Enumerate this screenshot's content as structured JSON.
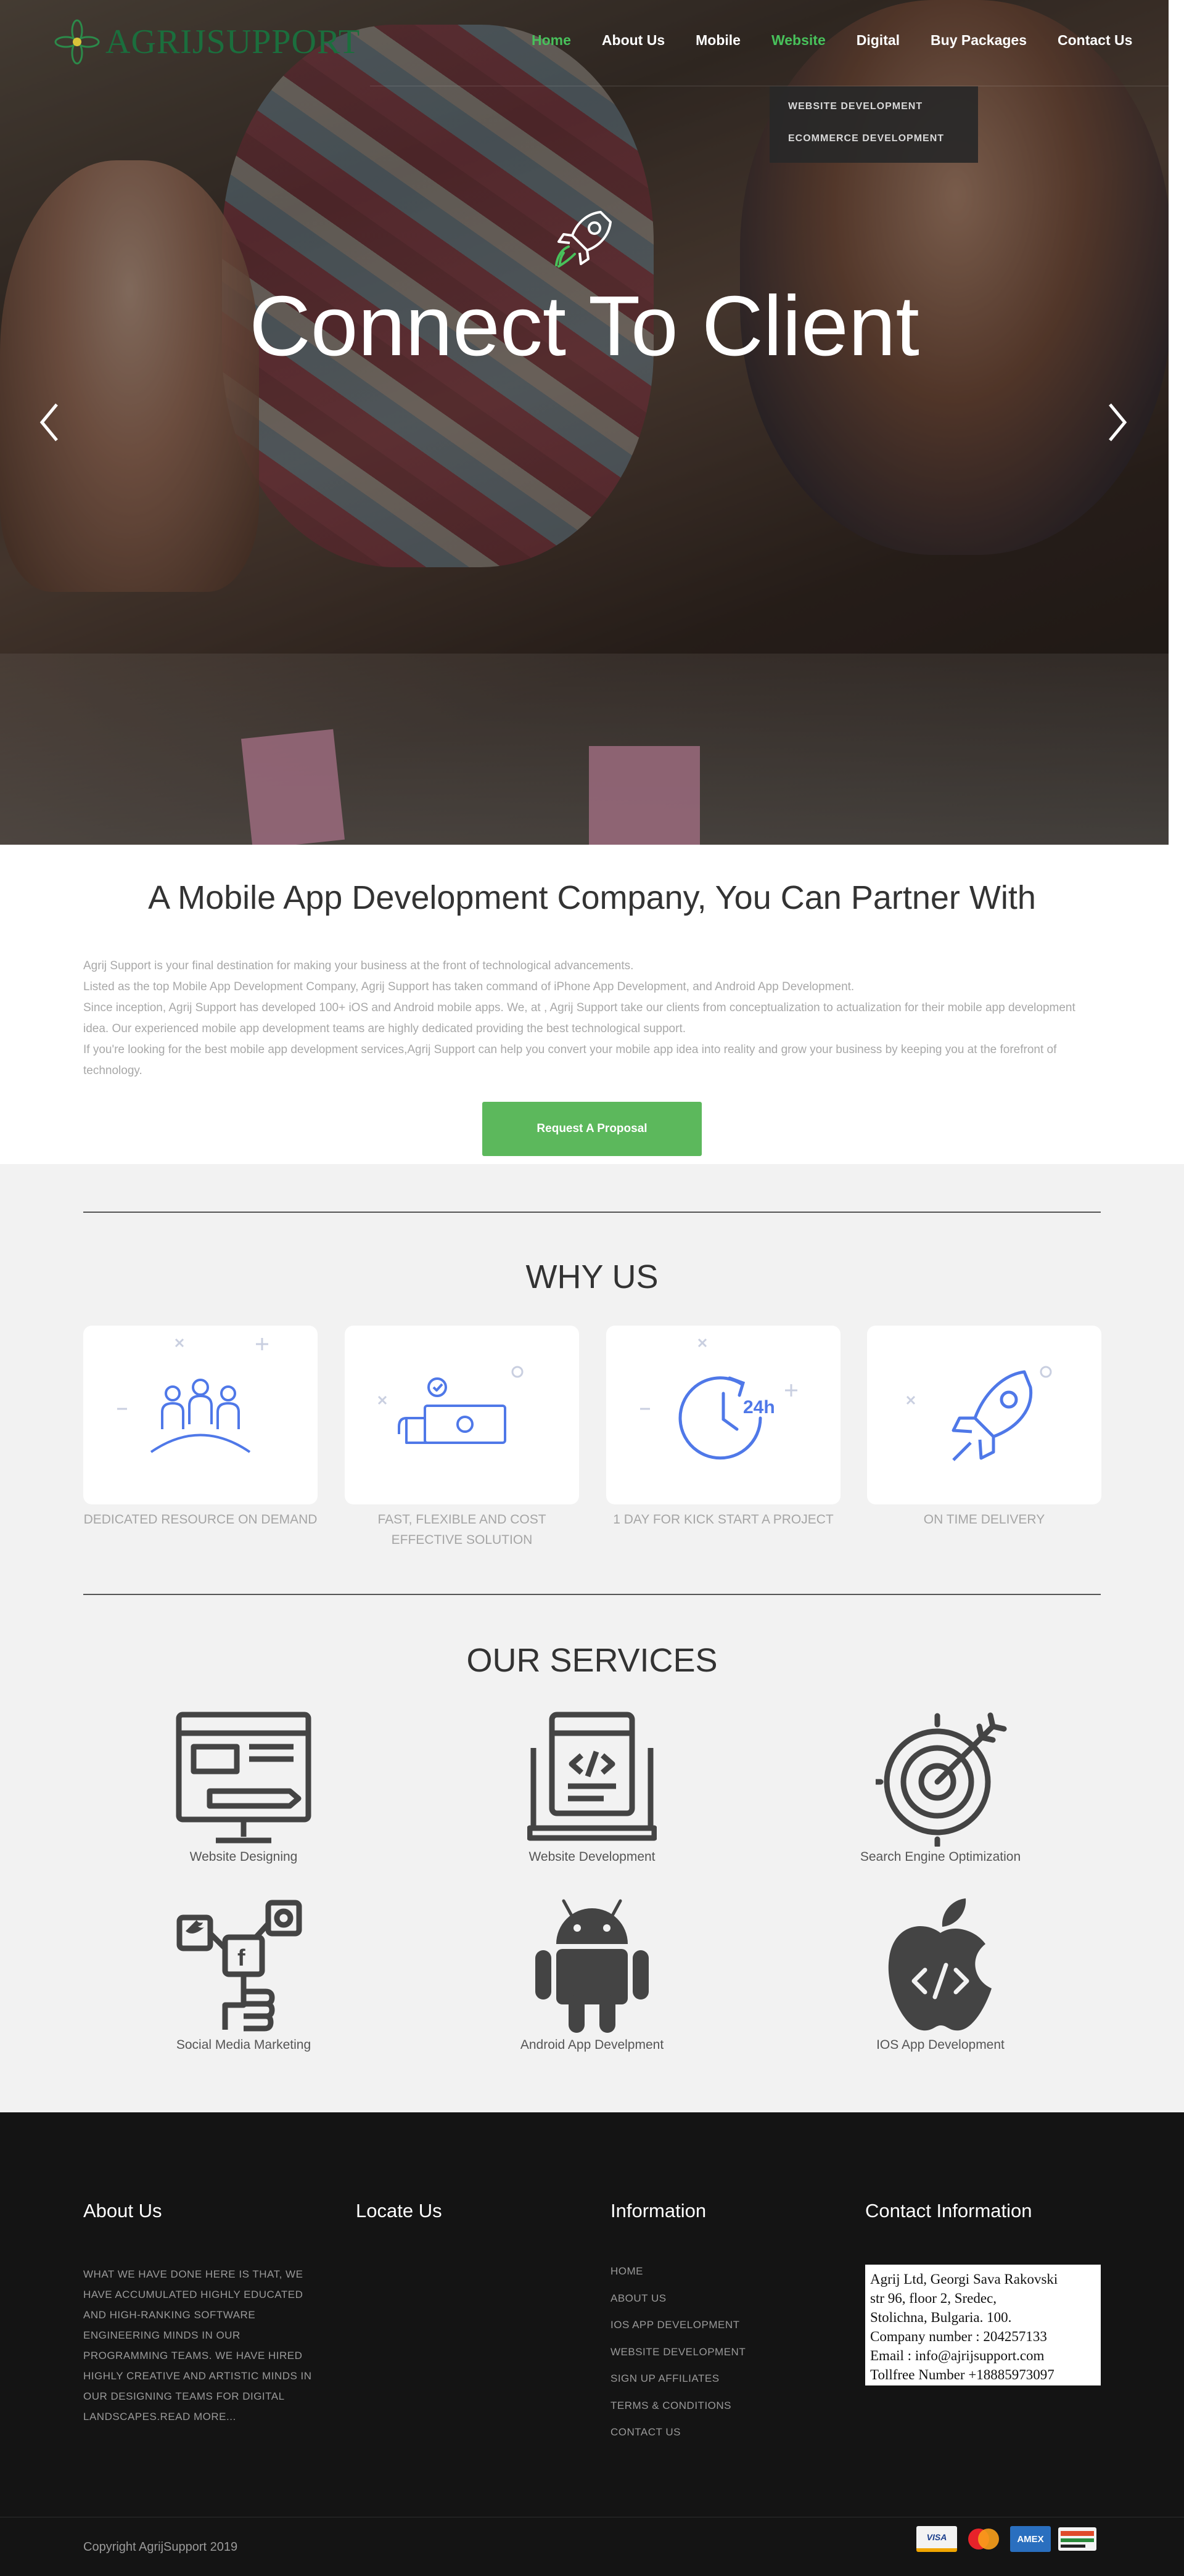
{
  "brand": {
    "name": "AGRIJSUPPORT",
    "color": "#1b6e3d"
  },
  "nav": {
    "items": [
      "Home",
      "About Us",
      "Mobile",
      "Website",
      "Digital",
      "Buy Packages",
      "Contact Us"
    ],
    "active": "Home",
    "active_color": "#48c15b",
    "dropdown": [
      "WEBSITE DEVELOPMENT",
      "ECOMMERCE DEVELOPMENT"
    ]
  },
  "hero": {
    "title": "Connect To Client",
    "icon": "rocket-icon",
    "prev": "chevron-left-icon",
    "next": "chevron-right-icon"
  },
  "intro": {
    "heading": "A Mobile App Development Company, You Can Partner With",
    "lines": [
      "Agrij Support is your final destination for making your business at the front of technological advancements.",
      "Listed as the top Mobile App Development Company, Agrij Support has taken command of iPhone App Development, and Android App Development.",
      "Since inception, Agrij Support has developed 100+ iOS and Android mobile apps. We, at , Agrij Support take our clients from conceptualization to actualization for their mobile app development idea. Our experienced mobile app development teams are highly dedicated providing the best technological support.",
      "If you're looking for the best mobile app development services,Agrij Support can help you convert your mobile app idea into reality and grow your business by keeping you at the forefront of technology."
    ],
    "button": "Request A Proposal",
    "button_color": "#5cb85c"
  },
  "why": {
    "title": "WHY US",
    "items": [
      {
        "label": "DEDICATED RESOURCE ON DEMAND",
        "icon": "team-icon"
      },
      {
        "label": "FAST, FLEXIBLE AND COST EFFECTIVE SOLUTION",
        "icon": "money-hand-icon"
      },
      {
        "label": "1 DAY FOR KICK START A PROJECT",
        "icon": "clock-24h-icon"
      },
      {
        "label": "ON TIME DELIVERY",
        "icon": "rocket-icon"
      }
    ],
    "icon_color": "#4f78e8"
  },
  "services": {
    "title": "OUR SERVICES",
    "items": [
      {
        "label": "Website Designing",
        "icon": "monitor-design-icon"
      },
      {
        "label": "Website Development",
        "icon": "laptop-code-icon"
      },
      {
        "label": "Search Engine Optimization",
        "icon": "target-icon"
      },
      {
        "label": "Social Media Marketing",
        "icon": "social-hand-icon"
      },
      {
        "label": "Android App Develpment",
        "icon": "android-icon"
      },
      {
        "label": "IOS App Development",
        "icon": "apple-code-icon"
      }
    ]
  },
  "footer": {
    "about_title": "About Us",
    "about_text": "WHAT WE HAVE DONE HERE IS THAT, WE HAVE ACCUMULATED HIGHLY EDUCATED AND HIGH-RANKING SOFTWARE ENGINEERING MINDS IN OUR PROGRAMMING TEAMS. WE HAVE HIRED HIGHLY CREATIVE AND ARTISTIC MINDS IN OUR DESIGNING TEAMS FOR DIGITAL LANDSCAPES.READ MORE...",
    "locate_title": "Locate Us",
    "info_title": "Information",
    "info_links": [
      "HOME",
      "ABOUT US",
      "IOS APP DEVELOPMENT",
      "WEBSITE DEVELOPMENT",
      "SIGN UP AFFILIATES",
      "TERMS & CONDITIONS",
      "CONTACT US"
    ],
    "contact_title": "Contact Information",
    "contact_lines": [
      "Agrij Ltd, Georgi Sava Rakovski",
      "str 96, floor 2, Sredec,",
      "Stolichna, Bulgaria. 100.",
      "Company number : 204257133",
      "Email : info@ajrijsupport.com",
      "Tollfree Number +18885973097"
    ],
    "copyright": "Copyright AgrijSupport 2019",
    "payment_cards": [
      "VISA",
      "MasterCard",
      "AMEX",
      "Discover"
    ]
  }
}
